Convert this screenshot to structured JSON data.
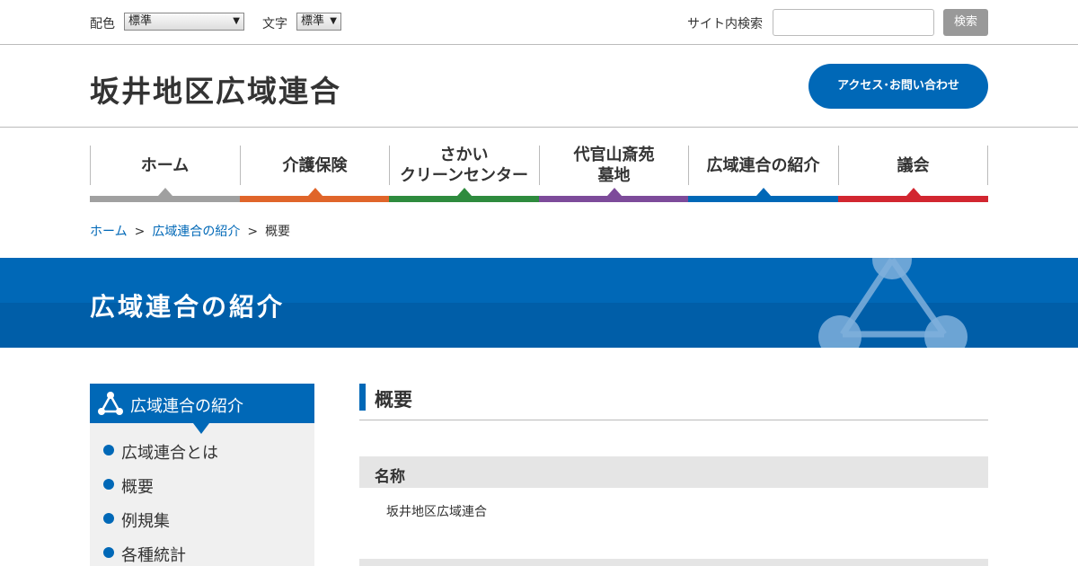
{
  "utility": {
    "color_label": "配色",
    "color_value": "標準",
    "text_label": "文字",
    "text_value": "標準",
    "search_label": "サイト内検索",
    "search_placeholder": "",
    "search_button": "検索"
  },
  "header": {
    "site_title": "坂井地区広域連合",
    "access_button": "アクセス･お問い合わせ"
  },
  "nav": [
    {
      "label": "ホーム",
      "color": "#a0a0a0"
    },
    {
      "label": "介護保険",
      "color": "#e0652a"
    },
    {
      "label": "さかい\nクリーンセンター",
      "color": "#2e8b3e"
    },
    {
      "label": "代官山斎苑\n墓地",
      "color": "#7d4b9a"
    },
    {
      "label": "広域連合の紹介",
      "color": "#0068b7"
    },
    {
      "label": "議会",
      "color": "#d22630"
    }
  ],
  "breadcrumb": {
    "home": "ホーム",
    "section": "広域連合の紹介",
    "current": "概要",
    "separator": ">"
  },
  "banner": {
    "title": "広域連合の紹介"
  },
  "sidebar": {
    "title": "広域連合の紹介",
    "items": [
      "広域連合とは",
      "概要",
      "例規集",
      "各種統計"
    ]
  },
  "main": {
    "heading": "概要",
    "sections": [
      {
        "heading": "名称",
        "body": "坂井地区広域連合"
      },
      {
        "heading": "",
        "body": ""
      }
    ]
  },
  "colors": {
    "accent": "#0068b7",
    "banner_dark": "#005ea8"
  }
}
